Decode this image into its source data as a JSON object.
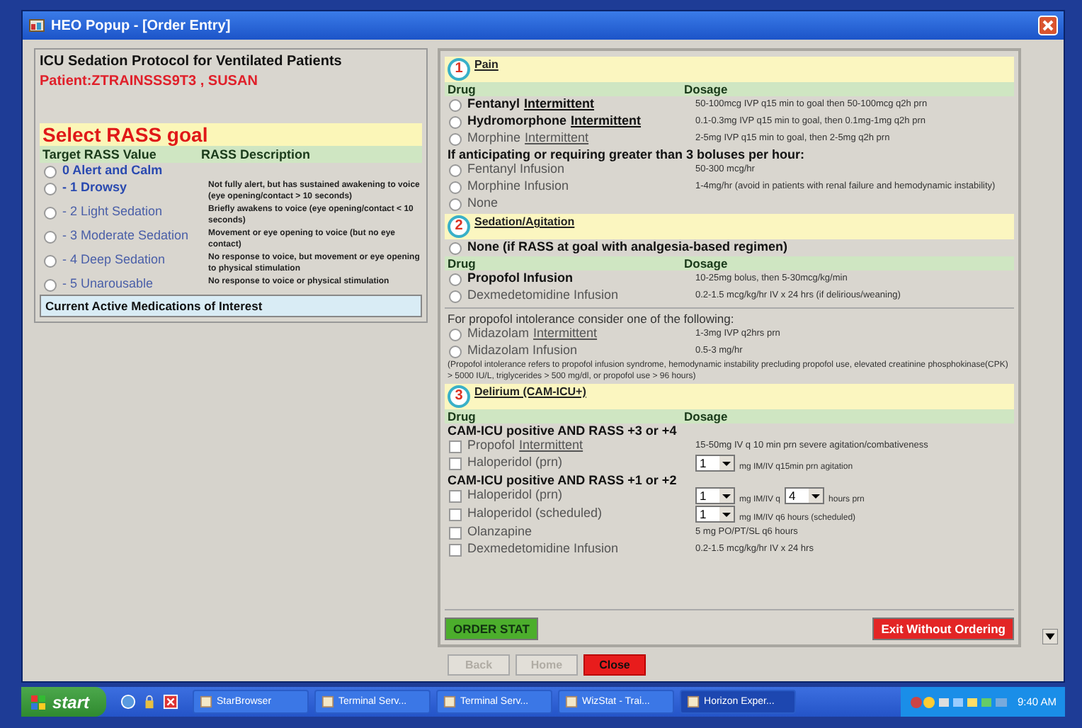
{
  "window": {
    "title": "HEO Popup - [Order Entry]"
  },
  "left": {
    "title": "ICU Sedation Protocol for Ventilated Patients",
    "patient": "Patient:ZTRAINSSS9T3 , SUSAN",
    "goal_heading": "Select RASS goal",
    "columns": [
      "Target RASS Value",
      "RASS Description"
    ],
    "rass_options": [
      {
        "value": "0 Alert and Calm",
        "bold": true,
        "selected": false
      },
      {
        "value": "- 1 Drowsy",
        "description": "Not fully alert, but has sustained awakening to voice (eye opening/contact > 10 seconds)",
        "bold": true,
        "selected": false
      },
      {
        "value": "- 2 Light Sedation",
        "description": "Briefly awakens to voice (eye opening/contact < 10 seconds)",
        "bold": false,
        "selected": false
      },
      {
        "value": "- 3 Moderate Sedation",
        "description": "Movement or eye opening to voice (but no eye contact)",
        "bold": false,
        "selected": false
      },
      {
        "value": "- 4 Deep Sedation",
        "description": "No response to voice, but movement or eye opening to physical stimulation",
        "bold": false,
        "selected": false
      },
      {
        "value": "- 5 Unarousable",
        "description": "No response to voice or physical stimulation",
        "bold": false,
        "selected": false
      }
    ],
    "meds_heading": "Current Active Medications of Interest"
  },
  "sections": [
    {
      "number": "1",
      "title": "Pain",
      "rows": [
        {
          "kind": "columns",
          "drug": "Drug",
          "dosage": "Dosage"
        },
        {
          "kind": "option",
          "name": "Fentanyl",
          "link": "Intermittent",
          "dosage": "50-100mcg IVP q15 min to goal then 50-100mcg q2h prn",
          "bold": true,
          "selected": false
        },
        {
          "kind": "option",
          "name": "Hydromorphone",
          "link": "Intermittent",
          "dosage": "0.1-0.3mg IVP q15 min to goal, then 0.1mg-1mg q2h prn",
          "bold": true,
          "selected": false
        },
        {
          "kind": "option",
          "name": "Morphine",
          "link": "Intermittent",
          "dosage": "2-5mg IVP q15 min to goal, then 2-5mg q2h prn",
          "bold": false,
          "selected": false
        },
        {
          "kind": "subheading",
          "text": "If anticipating or requiring greater than 3 boluses per hour:"
        },
        {
          "kind": "option",
          "name": "Fentanyl Infusion",
          "dosage": "50-300 mcg/hr",
          "bold": false,
          "selected": false
        },
        {
          "kind": "option",
          "name": "Morphine Infusion",
          "dosage": "1-4mg/hr (avoid in patients with renal failure and hemodynamic instability)",
          "bold": false,
          "selected": false
        },
        {
          "kind": "option",
          "name": "None",
          "bold": false,
          "selected": false
        }
      ]
    },
    {
      "number": "2",
      "title": "Sedation/Agitation",
      "rows": [
        {
          "kind": "option",
          "name": "None (if RASS at goal with analgesia-based regimen)",
          "bold": true,
          "selected": false
        },
        {
          "kind": "columns",
          "drug": "Drug",
          "dosage": "Dosage"
        },
        {
          "kind": "option",
          "name": "Propofol Infusion",
          "dosage": "10-25mg bolus, then 5-30mcg/kg/min",
          "bold": true,
          "selected": false
        },
        {
          "kind": "option",
          "name": "Dexmedetomidine Infusion",
          "dosage": "0.2-1.5 mcg/kg/hr IV x 24 hrs (if delirious/weaning)",
          "bold": false,
          "selected": false
        },
        {
          "kind": "text",
          "text": "For propofol intolerance consider one of the following:"
        },
        {
          "kind": "option",
          "name": "Midazolam",
          "link": "Intermittent",
          "dosage": "1-3mg IVP q2hrs prn",
          "bold": false,
          "selected": false
        },
        {
          "kind": "option",
          "name": "Midazolam Infusion",
          "dosage": "0.5-3 mg/hr",
          "bold": false,
          "selected": false
        },
        {
          "kind": "note",
          "text": "(Propofol intolerance refers to propofol infusion syndrome, hemodynamic instability precluding propofol use, elevated creatinine phosphokinase(CPK) > 5000 IU/L, triglycerides > 500 mg/dl, or propofol use > 96 hours)"
        }
      ]
    },
    {
      "number": "3",
      "title": "Delirium (CAM-ICU+)",
      "rows": [
        {
          "kind": "columns",
          "drug": "Drug",
          "dosage": "Dosage"
        },
        {
          "kind": "subheading",
          "text": "CAM-ICU positive AND RASS +3 or +4"
        },
        {
          "kind": "option",
          "name": "Propofol",
          "link": "Intermittent",
          "dosage": "15-50mg IV q 10 min prn severe agitation/combativeness",
          "bold": false,
          "checked": false
        },
        {
          "kind": "option",
          "name": "Haloperidol (prn)",
          "dose_parts": [
            {
              "kind": "select",
              "value": "1"
            },
            {
              "kind": "text",
              "text": "mg IM/IV q15min prn agitation"
            }
          ],
          "bold": false,
          "checked": false
        },
        {
          "kind": "subheading",
          "text": "CAM-ICU positive AND RASS +1 or +2"
        },
        {
          "kind": "option",
          "name": "Haloperidol (prn)",
          "dose_parts": [
            {
              "kind": "select",
              "value": "1"
            },
            {
              "kind": "text",
              "text": "mg IM/IV q"
            },
            {
              "kind": "select",
              "value": "4"
            },
            {
              "kind": "text",
              "text": "hours prn"
            }
          ],
          "bold": false,
          "checked": false
        },
        {
          "kind": "option",
          "name": "Haloperidol (scheduled)",
          "dose_parts": [
            {
              "kind": "select",
              "value": "1"
            },
            {
              "kind": "text",
              "text": "mg IM/IV q6 hours (scheduled)"
            }
          ],
          "bold": false,
          "checked": false
        },
        {
          "kind": "option",
          "name": "Olanzapine",
          "dosage": "5 mg PO/PT/SL q6 hours",
          "bold": false,
          "checked": false
        },
        {
          "kind": "option",
          "name": "Dexmedetomidine Infusion",
          "dosage": "0.2-1.5 mcg/kg/hr IV x 24 hrs",
          "bold": false,
          "checked": false
        }
      ]
    }
  ],
  "actions": [
    {
      "label": "ORDER STAT",
      "kind": "go"
    },
    {
      "label": "Exit Without Ordering",
      "kind": "danger"
    }
  ],
  "nav_buttons": [
    {
      "label": "Back",
      "kind": "plain",
      "disabled": true
    },
    {
      "label": "Home",
      "kind": "plain",
      "disabled": true
    },
    {
      "label": "Close",
      "kind": "danger",
      "disabled": false
    }
  ],
  "taskbar": {
    "start": "start",
    "tasks": [
      {
        "label": "StarBrowser",
        "active": false
      },
      {
        "label": "Terminal Serv...",
        "active": false
      },
      {
        "label": "Terminal Serv...",
        "active": false
      },
      {
        "label": "WizStat - Trai...",
        "active": false
      },
      {
        "label": "Horizon Exper...",
        "active": true
      }
    ],
    "clock": "9:40 AM"
  }
}
